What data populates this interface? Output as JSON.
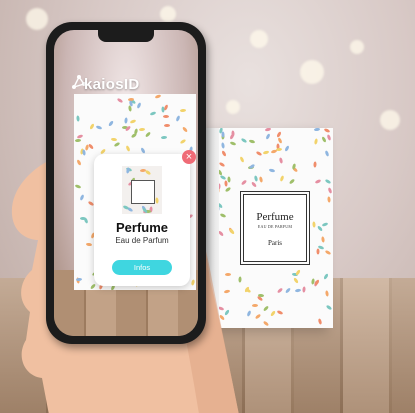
{
  "app": {
    "brand_name": "kaiosID"
  },
  "ar_card": {
    "title": "Perfume",
    "subtitle": "Eau de Parfum",
    "button_label": "Infos",
    "close_icon": "close-icon"
  },
  "product_box": {
    "name": "Perfume",
    "type_text": "EAU DE PARFUM",
    "city": "Paris"
  },
  "colors": {
    "accent_button": "#3fd6e0",
    "close_button": "#ef6b76",
    "leaf_palette": [
      "#f4a86a",
      "#7cc7c0",
      "#f2d36b",
      "#e58fa2",
      "#9fbf6a",
      "#8fb6e0",
      "#f08d6b"
    ]
  }
}
